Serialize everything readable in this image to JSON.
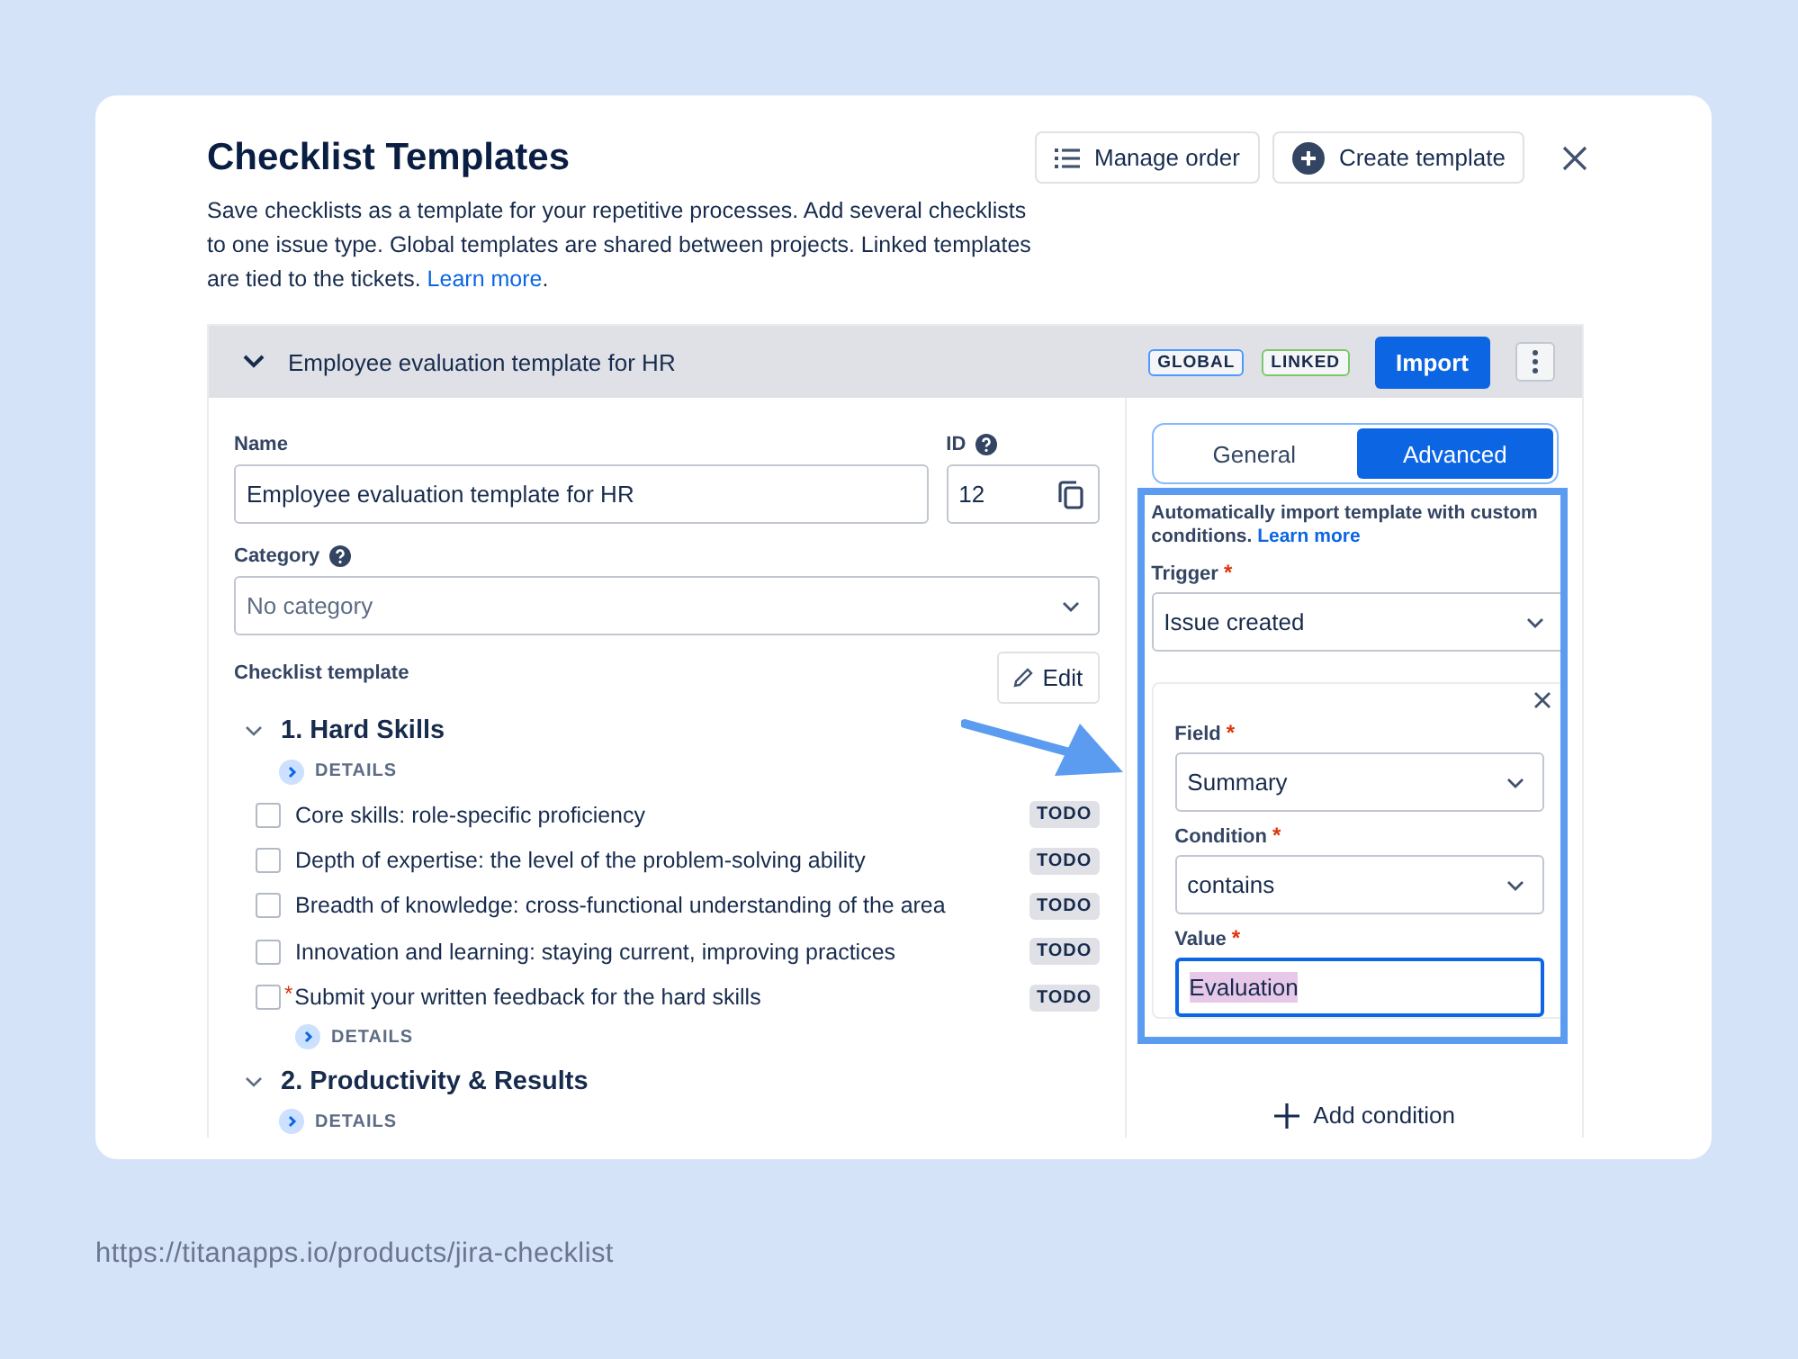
{
  "header": {
    "title": "Checklist Templates",
    "description": "Save checklists as a template for your repetitive processes. Add several checklists to one issue type. Global templates are shared between projects. Linked templates are tied to the tickets. ",
    "link": "Learn more",
    "suffix": ".",
    "buttons": [
      {
        "label": "Manage order",
        "kind": "list"
      },
      {
        "label": "Create template",
        "kind": "add"
      }
    ]
  },
  "template": {
    "title": "Employee evaluation template for HR",
    "expanded": true,
    "badges": [
      {
        "label": "GLOBAL",
        "color": "#4c9aff"
      },
      {
        "label": "LINKED",
        "color": "#7bc86c"
      }
    ],
    "import_button": "Import",
    "name": {
      "label": "Name",
      "value": "Employee evaluation template for HR"
    },
    "id": {
      "label": "ID",
      "value": "12"
    },
    "category": {
      "label": "Category",
      "value": "No category"
    },
    "checklist_label": "Checklist template",
    "edit_button": "Edit",
    "sections": [
      {
        "title": "1. Hard Skills",
        "expanded": true,
        "details": "DETAILS",
        "items": [
          {
            "text": "Core skills: role-specific proficiency",
            "checked": false,
            "status": "TODO"
          },
          {
            "text": "Depth of expertise: the level of the problem-solving ability",
            "checked": false,
            "status": "TODO"
          },
          {
            "text": "Breadth of knowledge: cross-functional understanding of the area",
            "checked": false,
            "status": "TODO"
          },
          {
            "text": "Innovation and learning: staying current, improving practices",
            "checked": false,
            "status": "TODO"
          },
          {
            "text": "Submit your written feedback for the hard skills",
            "checked": false,
            "status": "TODO",
            "required_mark": "*",
            "details": "DETAILS"
          }
        ]
      },
      {
        "title": "2. Productivity & Results",
        "expanded": true,
        "details": "DETAILS"
      }
    ],
    "tabs": [
      {
        "label": "General",
        "selected": false
      },
      {
        "label": "Advanced",
        "selected": true
      }
    ],
    "intro": "Automatically import template with custom conditions. ",
    "intro_link": "Learn more",
    "trigger": {
      "label": "Trigger",
      "required_mark": "*",
      "value": "Issue created"
    },
    "conditions": [
      {
        "label": "Field",
        "required_mark": "*",
        "value": "Summary",
        "kind": "select"
      },
      {
        "label": "Condition",
        "required_mark": "*",
        "value": "contains",
        "kind": "select"
      },
      {
        "label": "Value",
        "required_mark": "*",
        "value": "Evaluation",
        "kind": "text"
      }
    ],
    "add_condition": "Add condition"
  },
  "footer_url": "https://titanapps.io/products/jira-checklist"
}
